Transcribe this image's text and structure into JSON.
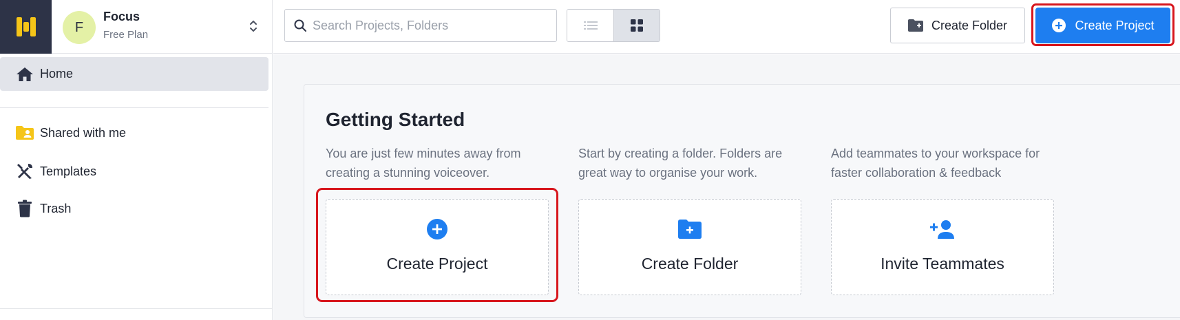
{
  "workspace": {
    "initial": "F",
    "name": "Focus",
    "plan": "Free Plan"
  },
  "sidebar": {
    "items": [
      {
        "label": "Home",
        "icon": "home-icon"
      },
      {
        "label": "Shared with me",
        "icon": "shared-folder-icon"
      },
      {
        "label": "Templates",
        "icon": "templates-tools-icon"
      },
      {
        "label": "Trash",
        "icon": "trash-icon"
      }
    ]
  },
  "topbar": {
    "search_placeholder": "Search Projects, Folders",
    "create_folder_label": "Create Folder",
    "create_project_label": "Create Project"
  },
  "getting_started": {
    "title": "Getting Started",
    "cards": [
      {
        "description": "You are just few minutes away from creating a stunning voiceover.",
        "label": "Create Project",
        "icon": "plus-circle-icon"
      },
      {
        "description": "Start by creating a folder. Folders are great way to organise your work.",
        "label": "Create Folder",
        "icon": "folder-plus-icon"
      },
      {
        "description": "Add teammates to your workspace for faster collaboration & feedback",
        "label": "Invite Teammates",
        "icon": "add-user-icon"
      }
    ]
  },
  "colors": {
    "accent": "#1e7ef0",
    "logo_bg": "#2d3347",
    "logo_mark": "#f5c518",
    "highlight": "#d7161d",
    "active_nav": "#e2e4ea"
  }
}
